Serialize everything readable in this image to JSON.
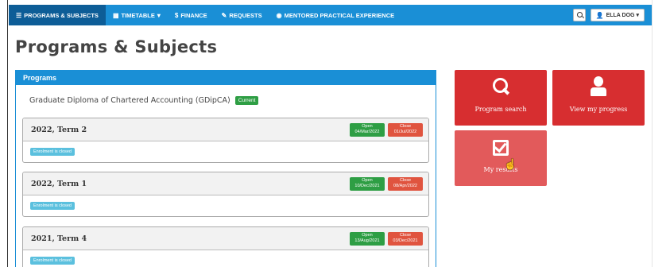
{
  "nav": {
    "items": [
      {
        "label": "Programs & Subjects",
        "icon": "list-icon"
      },
      {
        "label": "Timetable",
        "icon": "calendar-icon"
      },
      {
        "label": "Finance",
        "icon": "dollar-icon"
      },
      {
        "label": "Requests",
        "icon": "pencil-icon"
      },
      {
        "label": "Mentored Practical Experience",
        "icon": "eye-icon"
      }
    ],
    "user_label": "ELLA DOG"
  },
  "page_title": "Programs & Subjects",
  "programs": {
    "heading": "Programs",
    "program_name": "Graduate Diploma of Chartered Accounting (GDipCA)",
    "status_badge": "Current",
    "terms": [
      {
        "title": "2022, Term 2",
        "open_label": "Open",
        "open_date": "04/Mar/2022",
        "close_label": "Close",
        "close_date": "01/Jul/2022",
        "enrolment": "Enrolment is closed"
      },
      {
        "title": "2022, Term 1",
        "open_label": "Open",
        "open_date": "10/Dec/2021",
        "close_label": "Close",
        "close_date": "08/Apr/2022",
        "enrolment": "Enrolment is closed"
      },
      {
        "title": "2021, Term 4",
        "open_label": "Open",
        "open_date": "13/Aug/2021",
        "close_label": "Close",
        "close_date": "03/Dec/2021",
        "enrolment": "Enrolment is closed"
      }
    ]
  },
  "tiles": [
    {
      "label": "Program search",
      "icon": "search-icon"
    },
    {
      "label": "View my progress",
      "icon": "user-icon"
    },
    {
      "label": "My results",
      "icon": "check-square-icon"
    }
  ],
  "colors": {
    "nav": "#1a8fd6",
    "nav_active": "#0d5d97",
    "tile": "#d72e30",
    "tile_hover": "#e25a5b",
    "open": "#2e9e44",
    "close": "#e0543f",
    "info": "#5bc0de"
  }
}
